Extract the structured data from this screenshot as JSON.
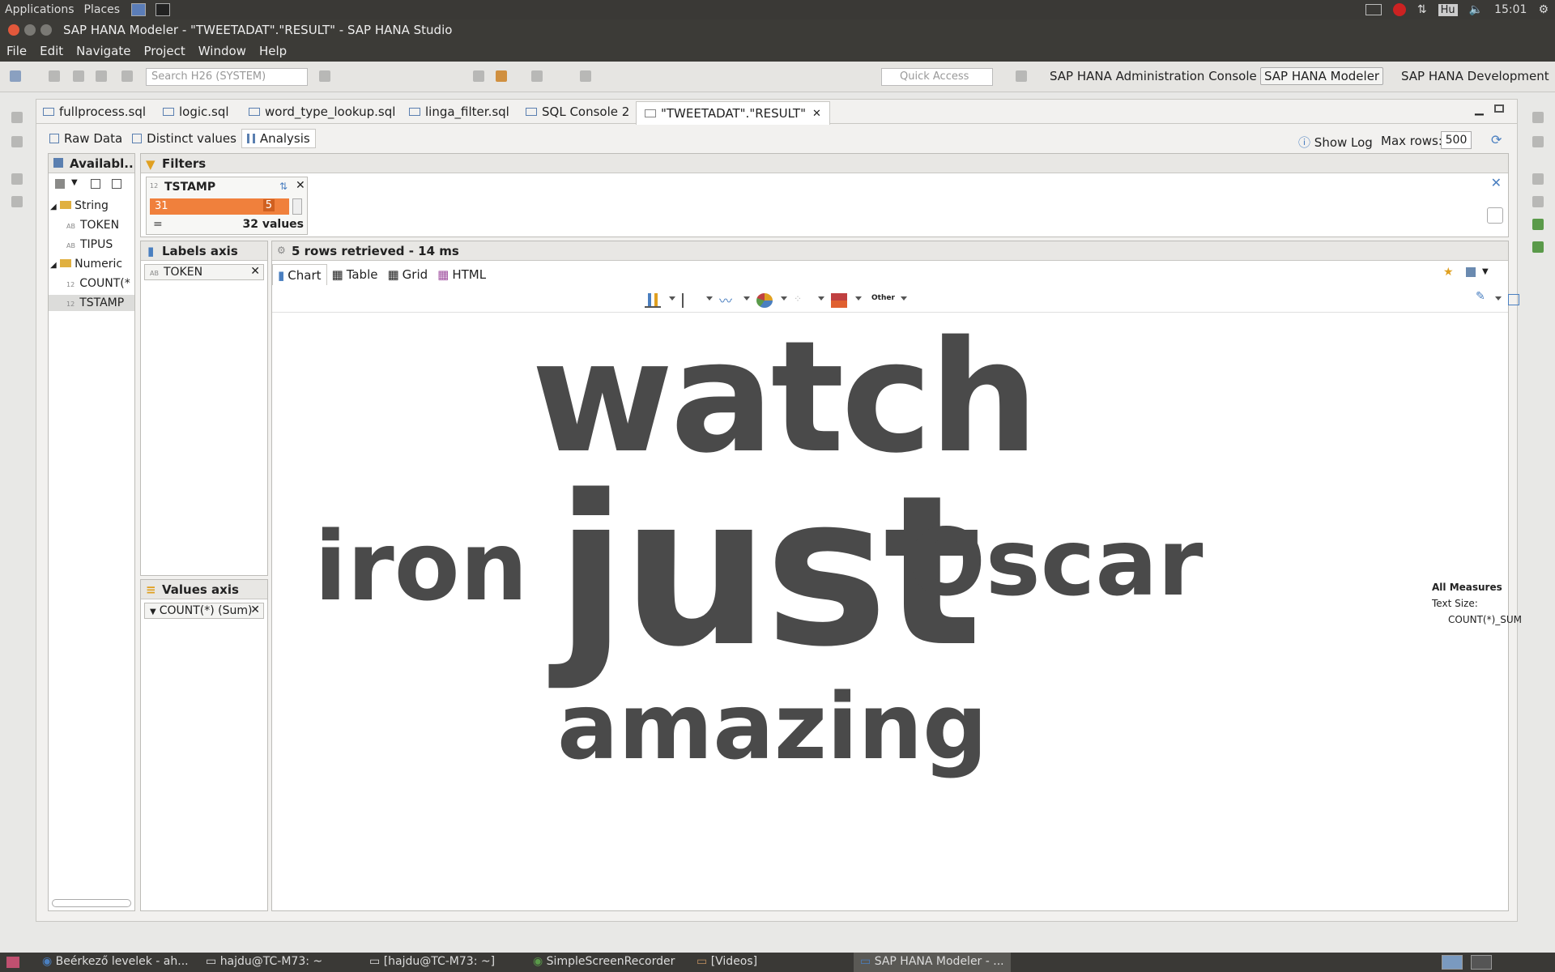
{
  "system_panel": {
    "applications": "Applications",
    "places": "Places",
    "keyboard_layout": "Hu",
    "clock": "15:01"
  },
  "window": {
    "title": "SAP HANA Modeler - \"TWEETADAT\".\"RESULT\" - SAP HANA Studio"
  },
  "menu": {
    "file": "File",
    "edit": "Edit",
    "navigate": "Navigate",
    "project": "Project",
    "window": "Window",
    "help": "Help"
  },
  "toolbar": {
    "search_placeholder": "Search H26 (SYSTEM)",
    "quick_access_placeholder": "Quick Access",
    "perspectives": [
      "SAP HANA Administration Console",
      "SAP HANA Modeler",
      "SAP HANA Development"
    ]
  },
  "editor_tabs": [
    "fullprocess.sql",
    "logic.sql",
    "word_type_lookup.sql",
    "linga_filter.sql",
    "SQL Console 2",
    "\"TWEETADAT\".\"RESULT\""
  ],
  "sub_tabs": {
    "raw_data": "Raw Data",
    "distinct_values": "Distinct values",
    "analysis": "Analysis"
  },
  "show_log": "Show Log",
  "max_rows": {
    "label": "Max rows:",
    "value": "500"
  },
  "available": {
    "title": "Availabl...",
    "groups": [
      {
        "name": "String",
        "items": [
          "TOKEN",
          "TIPUS"
        ]
      },
      {
        "name": "Numeric",
        "items": [
          "COUNT(*",
          "TSTAMP"
        ]
      }
    ]
  },
  "filters": {
    "title": "Filters",
    "filter": {
      "field": "TSTAMP",
      "range_start": "31",
      "range_end": "5",
      "operator": "=",
      "summary": "32 values"
    }
  },
  "labels_axis": {
    "title": "Labels axis",
    "item": "TOKEN"
  },
  "values_axis": {
    "title": "Values axis",
    "item": "COUNT(*) (Sum)"
  },
  "result": {
    "status": "5 rows retrieved - 14 ms",
    "view_tabs": {
      "chart": "Chart",
      "table": "Table",
      "grid": "Grid",
      "html": "HTML"
    },
    "chart_type_other": "Other"
  },
  "legend": {
    "title": "All Measures",
    "text_size_label": "Text Size:",
    "measure": "COUNT(*)_SUM"
  },
  "chart_data": {
    "type": "word-cloud",
    "words": [
      {
        "text": "watch"
      },
      {
        "text": "iron"
      },
      {
        "text": "just"
      },
      {
        "text": "Oscar"
      },
      {
        "text": "amazing"
      }
    ]
  },
  "taskbar": [
    "Beérkező levelek - ah...",
    "hajdu@TC-M73: ~",
    "[hajdu@TC-M73: ~]",
    "SimpleScreenRecorder",
    "[Videos]",
    "SAP HANA Modeler - ..."
  ]
}
